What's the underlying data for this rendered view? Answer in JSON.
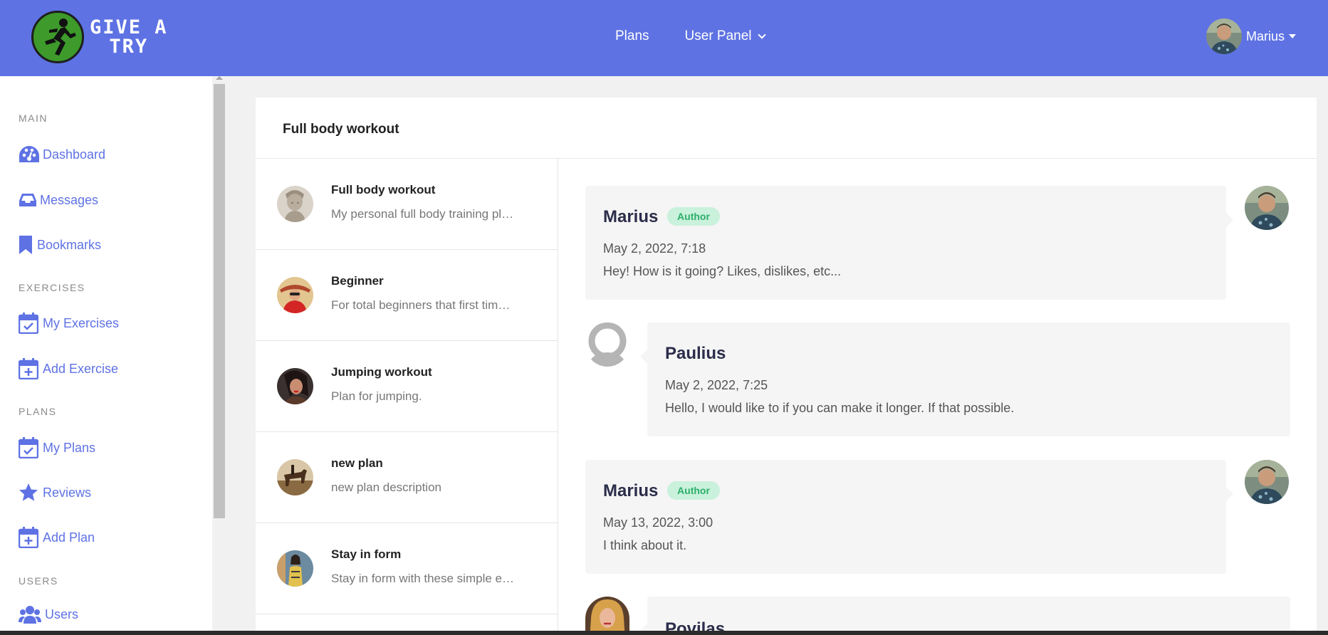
{
  "header": {
    "logo_text_line1": "GIVE A",
    "logo_text_line2": "TRY",
    "nav": {
      "plans": "Plans",
      "user_panel": "User Panel"
    },
    "user": {
      "name": "Marius"
    }
  },
  "sidebar": {
    "sections": {
      "main": "MAIN",
      "exercises": "EXERCISES",
      "plans": "PLANS",
      "users": "USERS"
    },
    "items": [
      {
        "label": "Dashboard",
        "icon": "palette-icon"
      },
      {
        "label": "Messages",
        "icon": "inbox-icon"
      },
      {
        "label": "Bookmarks",
        "icon": "bookmark-icon"
      },
      {
        "label": "My Exercises",
        "icon": "calendar-check-icon"
      },
      {
        "label": "Add Exercise",
        "icon": "calendar-plus-icon"
      },
      {
        "label": "My Plans",
        "icon": "calendar-check-icon"
      },
      {
        "label": "Reviews",
        "icon": "star-icon"
      },
      {
        "label": "Add Plan",
        "icon": "calendar-plus-icon"
      },
      {
        "label": "Users",
        "icon": "users-icon"
      }
    ]
  },
  "card": {
    "title": "Full body workout"
  },
  "plans": [
    {
      "title": "Full body workout",
      "description": "My personal full body training plan for all muscles"
    },
    {
      "title": "Beginner",
      "description": "For total beginners that first time in the gym"
    },
    {
      "title": "Jumping workout",
      "description": "Plan for jumping."
    },
    {
      "title": "new plan",
      "description": "new plan description"
    },
    {
      "title": "Stay in form",
      "description": "Stay in form with these simple exercises"
    }
  ],
  "messages": [
    {
      "name": "Marius",
      "badge": "Author",
      "date": "May 2, 2022, 7:18",
      "text": "Hey! How is it going? Likes, dislikes, etc..."
    },
    {
      "name": "Paulius",
      "badge": "",
      "date": "May 2, 2022, 7:25",
      "text": "Hello, I would like to if you can make it longer. If that possible."
    },
    {
      "name": "Marius",
      "badge": "Author",
      "date": "May 13, 2022, 3:00",
      "text": "I think about it."
    },
    {
      "name": "Povilas",
      "badge": "",
      "date": "",
      "text": ""
    }
  ],
  "colors": {
    "accent": "#5e72e4",
    "author_badge_bg": "#c9f1dc",
    "author_badge_text": "#2daf6a"
  }
}
